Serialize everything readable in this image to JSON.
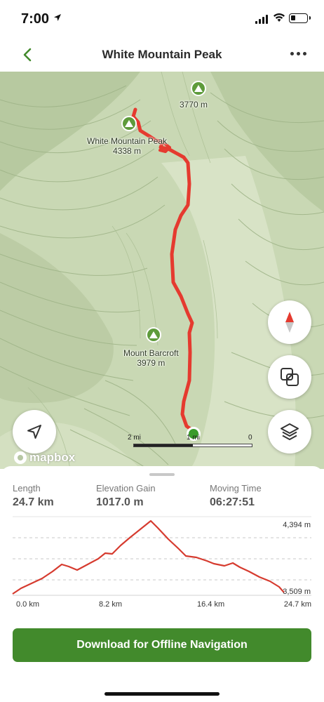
{
  "status_bar": {
    "time": "7:00"
  },
  "header": {
    "title": "White Mountain Peak"
  },
  "map": {
    "peaks": [
      {
        "name": "",
        "elevation": "3770 m"
      },
      {
        "name": "White Mountain Peak",
        "elevation": "4338 m"
      },
      {
        "name": "Mount Barcroft",
        "elevation": "3979 m"
      }
    ],
    "scale": {
      "left": "2 mi",
      "middle": "1 mi",
      "right": "0"
    },
    "attribution": "mapbox",
    "route_color": "#e53a2f",
    "terrain_color": "#c9d8b4"
  },
  "stats": [
    {
      "label": "Length",
      "value": "24.7 km"
    },
    {
      "label": "Elevation Gain",
      "value": "1017.0 m"
    },
    {
      "label": "Moving Time",
      "value": "06:27:51"
    }
  ],
  "elevation_profile": {
    "y_max_label": "4,394 m",
    "y_min_label": "3,509 m",
    "x_labels": [
      "0.0 km",
      "8.2 km",
      "16.4 km",
      "24.7 km"
    ]
  },
  "actions": {
    "download_label": "Download for Offline Navigation"
  },
  "colors": {
    "accent": "#428a2c",
    "route": "#e53a2f"
  }
}
